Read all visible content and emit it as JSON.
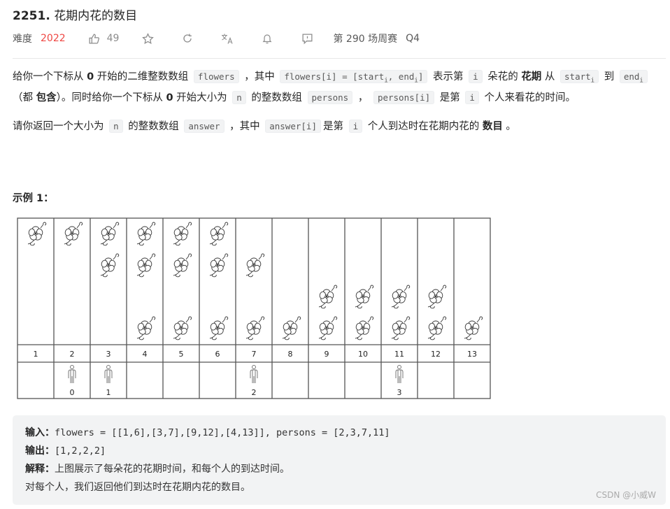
{
  "header": {
    "number": "2251.",
    "title": "花期内花的数目",
    "difficulty_label": "难度",
    "difficulty_value": "2022",
    "likes": "49",
    "contest": "第 290 场周赛",
    "quarter": "Q4",
    "icons": [
      "thumbs-up-icon",
      "star-icon",
      "refresh-icon",
      "translate-icon",
      "bell-icon",
      "feedback-icon"
    ],
    "difficulty_color": "#ef4743"
  },
  "description": [
    [
      {
        "type": "text",
        "text": "给你一个下标从 "
      },
      {
        "type": "bold",
        "text": "0"
      },
      {
        "type": "text",
        "text": " 开始的二维整数数组 "
      },
      {
        "type": "code",
        "text": "flowers"
      },
      {
        "type": "text",
        "text": " ，其中 "
      },
      {
        "type": "code",
        "text": "flowers[i] = [start",
        "sub": "i",
        "after": ", end",
        "sub2": "i",
        "tail": "]"
      },
      {
        "type": "text",
        "text": " 表示第 "
      },
      {
        "type": "code",
        "text": "i"
      },
      {
        "type": "text",
        "text": " 朵花的 "
      },
      {
        "type": "bold",
        "text": "花期"
      },
      {
        "type": "text",
        "text": " 从 "
      },
      {
        "type": "code",
        "text": "start",
        "sub": "i"
      },
      {
        "type": "text",
        "text": " 到 "
      },
      {
        "type": "code",
        "text": "end",
        "sub": "i"
      },
      {
        "type": "text",
        "text": " （都 "
      },
      {
        "type": "bold",
        "text": "包含"
      },
      {
        "type": "text",
        "text": "）。同时给你一个下标从 "
      },
      {
        "type": "bold",
        "text": "0"
      },
      {
        "type": "text",
        "text": " 开始大小为 "
      },
      {
        "type": "code",
        "text": "n"
      },
      {
        "type": "text",
        "text": " 的整数数组 "
      },
      {
        "type": "code",
        "text": "persons"
      },
      {
        "type": "text",
        "text": " ， "
      },
      {
        "type": "code",
        "text": "persons[i]"
      },
      {
        "type": "text",
        "text": " 是第 "
      },
      {
        "type": "code",
        "text": "i"
      },
      {
        "type": "text",
        "text": " 个人来看花的时间。"
      }
    ],
    [
      {
        "type": "text",
        "text": "请你返回一个大小为 "
      },
      {
        "type": "code",
        "text": "n"
      },
      {
        "type": "text",
        "text": " 的整数数组 "
      },
      {
        "type": "code",
        "text": "answer"
      },
      {
        "type": "text",
        "text": " ，其中 "
      },
      {
        "type": "code",
        "text": "answer[i]"
      },
      {
        "type": "text",
        "text": "是第 "
      },
      {
        "type": "code",
        "text": "i"
      },
      {
        "type": "text",
        "text": " 个人到达时在花期内花的 "
      },
      {
        "type": "bold",
        "text": "数目"
      },
      {
        "type": "text",
        "text": " 。"
      }
    ]
  ],
  "example": {
    "heading": "示例 1：",
    "figure": {
      "days": [
        "1",
        "2",
        "3",
        "4",
        "5",
        "6",
        "7",
        "8",
        "9",
        "10",
        "11",
        "12",
        "13"
      ],
      "flowers": [
        [
          1,
          6
        ],
        [
          3,
          7
        ],
        [
          9,
          12
        ],
        [
          4,
          13
        ]
      ],
      "persons": [
        2,
        3,
        7,
        11
      ],
      "person_labels": [
        "0",
        "1",
        "2",
        "3"
      ]
    },
    "input_label": "输入：",
    "input_value": "flowers = [[1,6],[3,7],[9,12],[4,13]], persons = [2,3,7,11]",
    "output_label": "输出：",
    "output_value": "[1,2,2,2]",
    "explain_label": "解释：",
    "explain_value": "上图展示了每朵花的花期时间，和每个人的到达时间。",
    "explain_line2": "对每个人，我们返回他们到达时在花期内花的数目。"
  },
  "watermark": "CSDN @小威W"
}
